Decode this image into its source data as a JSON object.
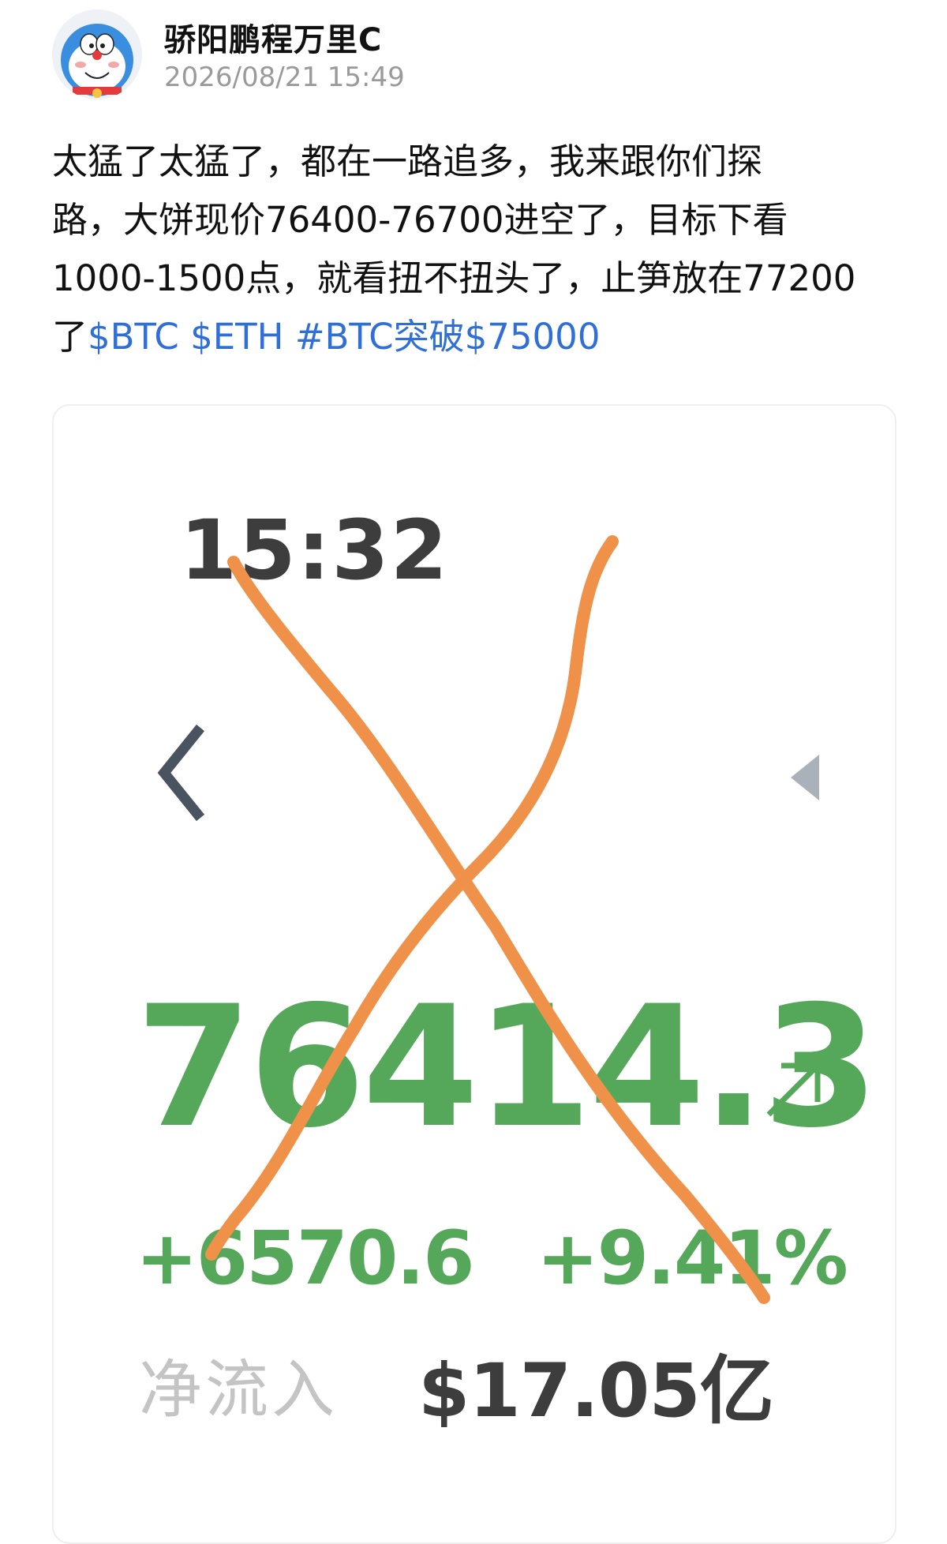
{
  "post": {
    "author": {
      "name": "骄阳鹏程万里C",
      "avatar_icon": "doraemon-avatar"
    },
    "timestamp": "2026/08/21 15:49",
    "text": {
      "line1": "太猛了太猛了，都在一路追多，我来跟你们探",
      "line2": "路，大饼现价76400-76700进空了，目标下看",
      "line3": "1000-1500点，就看扭不扭头了，止笋放在77200",
      "line4_prefix": "了",
      "tags": [
        "$BTC",
        "$ETH",
        "#BTC突破$75000"
      ]
    },
    "link_color": "#2f6fd6"
  },
  "image_card": {
    "time": "15:32",
    "price": "76414.3",
    "change_abs": "+6570.6",
    "change_pct": "+9.41%",
    "inflow_label": "净流入",
    "inflow_value": "$17.05亿",
    "icons": {
      "back": "chevron-left-icon",
      "play": "play-triangle-icon",
      "trend": "arrow-up-right-icon",
      "cross": "hand-drawn-cross"
    },
    "colors": {
      "up_green": "#55a85a",
      "cross_orange": "#f0914a",
      "dark_text": "#3d3d3d"
    }
  }
}
